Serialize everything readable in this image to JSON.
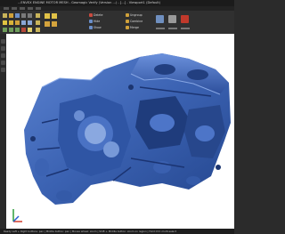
{
  "window": {
    "title": "...ENVEX ENGINE MOTOR MESH - Geomagic Verify (Version ...) - [...] - Viewport1 (Default)"
  },
  "ribbon": {
    "tools": [
      {
        "label": "Delete"
      },
      {
        "label": "Hide"
      },
      {
        "label": "Show"
      },
      {
        "label": "Ungroup"
      },
      {
        "label": "Combine"
      },
      {
        "label": "Merge"
      }
    ]
  },
  "statusbar": {
    "text": "Ready   Left + Right buttons: pan  |  Middle button: pan  |  Mouse wheel: zoom  |  Shift + Middle button: zoom on region  |  Hold Ctrl: multi-select"
  },
  "colors": {
    "mesh": "#3f67b8",
    "viewport_bg": "#ffffff",
    "chrome": "#2b2b2b"
  }
}
